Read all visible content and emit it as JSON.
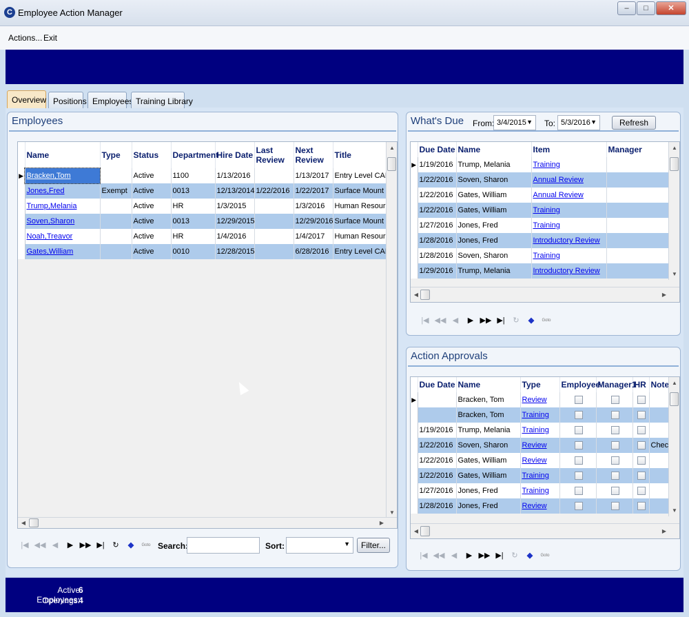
{
  "window": {
    "title": "Employee Action Manager",
    "minimize": "–",
    "maximize": "□",
    "close": "✕"
  },
  "menu": [
    {
      "label": "Actions..."
    },
    {
      "label": "Exit"
    }
  ],
  "tabs": [
    {
      "label": "Overview",
      "active": true
    },
    {
      "label": "Positions"
    },
    {
      "label": "Employees"
    },
    {
      "label": "Training Library"
    }
  ],
  "employees": {
    "title": "Employees",
    "columns": [
      "Name",
      "Type",
      "Status",
      "Department",
      "Hire Date",
      "Last Review",
      "Next Review",
      "Title"
    ],
    "rows": [
      [
        "Bracken,Tom",
        "",
        "Active",
        "1100",
        "1/13/2016",
        "",
        "1/13/2017",
        "Entry Level CAM"
      ],
      [
        "Jones,Fred",
        "Exempt",
        "Active",
        "0013",
        "12/13/2014",
        "1/22/2016",
        "1/22/2017",
        "Surface Mount ("
      ],
      [
        "Trump,Melania",
        "",
        "Active",
        "HR",
        "1/3/2015",
        "",
        "1/3/2016",
        "Human Resource"
      ],
      [
        "Soven,Sharon",
        "",
        "Active",
        "0013",
        "12/29/2015",
        "",
        "12/29/2016",
        "Surface Mount ("
      ],
      [
        "Noah,Treavor",
        "",
        "Active",
        "HR",
        "1/4/2016",
        "",
        "1/4/2017",
        "Human Resource"
      ],
      [
        "Gates,William",
        "",
        "Active",
        "0010",
        "12/28/2015",
        "",
        "6/28/2016",
        "Entry Level CAM"
      ]
    ],
    "search_label": "Search:",
    "search_value": "",
    "sort_label": "Sort:",
    "sort_value": "",
    "filter_button": "Filter..."
  },
  "whats_due": {
    "title": "What's Due",
    "from_label": "From:",
    "from_value": "3/4/2015",
    "to_label": "To:",
    "to_value": "5/3/2016",
    "refresh_button": "Refresh",
    "columns": [
      "Due Date",
      "Name",
      "Item",
      "Manager"
    ],
    "rows": [
      [
        "1/19/2016",
        "Trump, Melania",
        "Training",
        ""
      ],
      [
        "1/22/2016",
        "Soven, Sharon",
        "Annual Review",
        ""
      ],
      [
        "1/22/2016",
        "Gates, William",
        "Annual Review",
        ""
      ],
      [
        "1/22/2016",
        "Gates, William",
        "Training",
        ""
      ],
      [
        "1/27/2016",
        "Jones, Fred",
        "Training",
        ""
      ],
      [
        "1/28/2016",
        "Jones, Fred",
        "Introductory Review",
        ""
      ],
      [
        "1/28/2016",
        "Soven, Sharon",
        "Training",
        ""
      ],
      [
        "1/29/2016",
        "Trump, Melania",
        "Introductory Review",
        ""
      ]
    ]
  },
  "approvals": {
    "title": "Action Approvals",
    "columns": [
      "Due Date",
      "Name",
      "Type",
      "Employee",
      "Manager1",
      "HR",
      "Note"
    ],
    "rows": [
      [
        "",
        "Bracken, Tom",
        "Review",
        ""
      ],
      [
        "",
        "Bracken, Tom",
        "Training",
        ""
      ],
      [
        "1/19/2016",
        "Trump, Melania",
        "Training",
        ""
      ],
      [
        "1/22/2016",
        "Soven, Sharon",
        "Review",
        "Chec"
      ],
      [
        "1/22/2016",
        "Gates, William",
        "Review",
        ""
      ],
      [
        "1/22/2016",
        "Gates, William",
        "Training",
        ""
      ],
      [
        "1/27/2016",
        "Jones, Fred",
        "Training",
        ""
      ],
      [
        "1/28/2016",
        "Jones, Fred",
        "Review",
        ""
      ]
    ]
  },
  "navigator": {
    "first": "|◀",
    "prev_page": "◀◀",
    "prev": "◀",
    "next": "▶",
    "next_page": "▶▶",
    "last": "▶|",
    "refresh": "↻",
    "goto": "Goto"
  },
  "status": {
    "active_employees_label": "Active Employees:",
    "active_employees_value": "6",
    "openings_label": "Openings:",
    "openings_value": "4"
  }
}
